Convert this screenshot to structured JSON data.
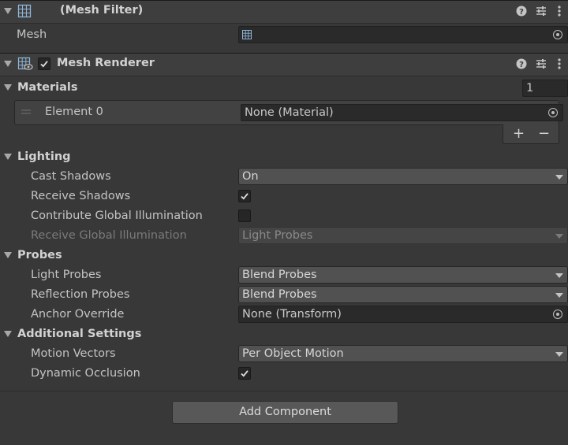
{
  "mesh_filter": {
    "title": "(Mesh Filter)",
    "mesh_label": "Mesh",
    "mesh_value": ""
  },
  "mesh_renderer": {
    "title": "Mesh Renderer",
    "enabled": true,
    "materials": {
      "label": "Materials",
      "size": "1",
      "elements": [
        {
          "label": "Element 0",
          "value": "None (Material)"
        }
      ],
      "add_label": "+",
      "remove_label": "−"
    },
    "lighting": {
      "label": "Lighting",
      "cast_shadows_label": "Cast Shadows",
      "cast_shadows_value": "On",
      "receive_shadows_label": "Receive Shadows",
      "receive_shadows_checked": true,
      "contribute_gi_label": "Contribute Global Illumination",
      "contribute_gi_checked": false,
      "receive_gi_label": "Receive Global Illumination",
      "receive_gi_value": "Light Probes"
    },
    "probes": {
      "label": "Probes",
      "light_probes_label": "Light Probes",
      "light_probes_value": "Blend Probes",
      "reflection_probes_label": "Reflection Probes",
      "reflection_probes_value": "Blend Probes",
      "anchor_override_label": "Anchor Override",
      "anchor_override_value": "None (Transform)"
    },
    "additional": {
      "label": "Additional Settings",
      "motion_vectors_label": "Motion Vectors",
      "motion_vectors_value": "Per Object Motion",
      "dynamic_occlusion_label": "Dynamic Occlusion",
      "dynamic_occlusion_checked": true
    }
  },
  "add_component_label": "Add Component",
  "icons": [
    "foldout-arrow-icon",
    "mesh-filter-icon",
    "mesh-renderer-icon",
    "help-icon",
    "presets-icon",
    "more-menu-icon",
    "object-picker-icon",
    "checkmark-icon",
    "drag-handle-icon",
    "dropdown-caret-icon"
  ],
  "colors": {
    "background": "#383838",
    "header": "#3e3e3e",
    "field": "#2a2a2a",
    "dropdown": "#515151",
    "text": "#c4c4c4"
  }
}
